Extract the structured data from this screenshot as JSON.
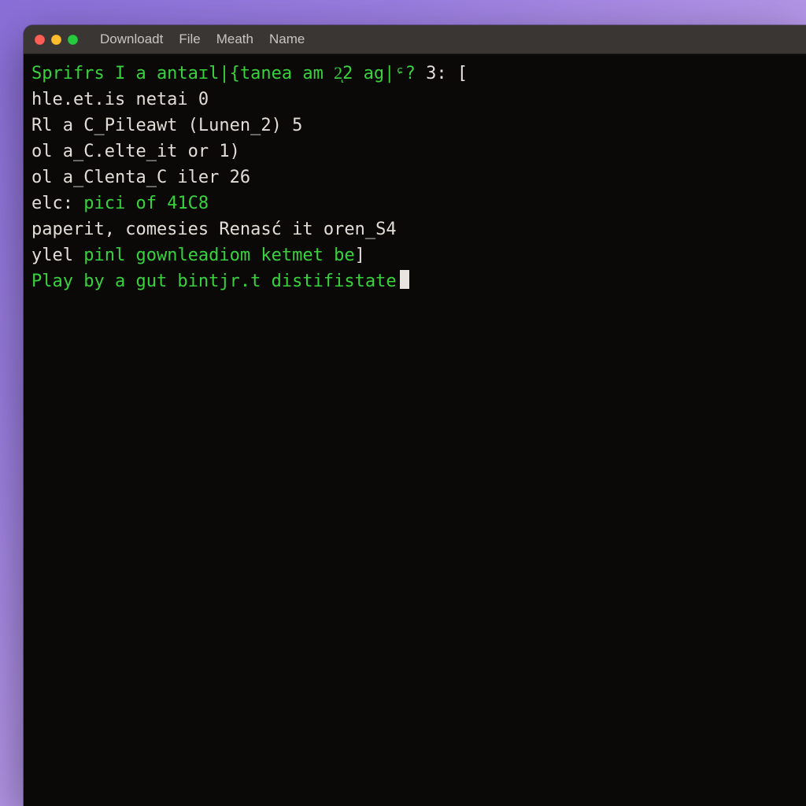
{
  "window": {
    "menu": [
      "Downloadt",
      "File",
      "Meath",
      "Name"
    ]
  },
  "terminal": {
    "lines": [
      {
        "segments": [
          {
            "cls": "g",
            "text": "Sprifrs I a antaɪl|{tanea am 2ͅ2 ag|ᶝ?"
          },
          {
            "cls": "w",
            "text": " 3: "
          },
          {
            "cls": "cursor-ibeam",
            "text": "["
          }
        ]
      },
      {
        "segments": [
          {
            "cls": "w",
            "text": "hle.et.is netai 0"
          }
        ]
      },
      {
        "segments": [
          {
            "cls": "w",
            "text": "Rl a C_Pileawt (Lunen_2) 5"
          }
        ]
      },
      {
        "segments": [
          {
            "cls": "w",
            "text": "ol a_C.elte_it or 1)"
          }
        ]
      },
      {
        "segments": [
          {
            "cls": "w",
            "text": "ol a_Clenta_C iler 26"
          }
        ]
      },
      {
        "segments": [
          {
            "cls": "w",
            "text": "elc: "
          },
          {
            "cls": "g",
            "text": "pici of 41C8"
          }
        ]
      },
      {
        "segments": [
          {
            "cls": "w",
            "text": "paperit, comesies Renasć it oren_S4"
          }
        ]
      },
      {
        "segments": [
          {
            "cls": "w",
            "text": "ylel "
          },
          {
            "cls": "g",
            "text": "pinl gownleadiom ketmet be"
          },
          {
            "cls": "w",
            "text": "]"
          }
        ]
      },
      {
        "segments": [
          {
            "cls": "g",
            "text": "Play by a gut bintjr.t distifistate"
          },
          {
            "cls": "cursor-block",
            "text": ""
          }
        ]
      }
    ]
  },
  "colors": {
    "term_green": "#38d23c",
    "term_fg": "#e2ddd7",
    "term_bg": "#0a0908",
    "titlebar_bg": "#3a3634",
    "traffic_close": "#ff5f56",
    "traffic_min": "#ffbd2e",
    "traffic_zoom": "#27c93f"
  }
}
